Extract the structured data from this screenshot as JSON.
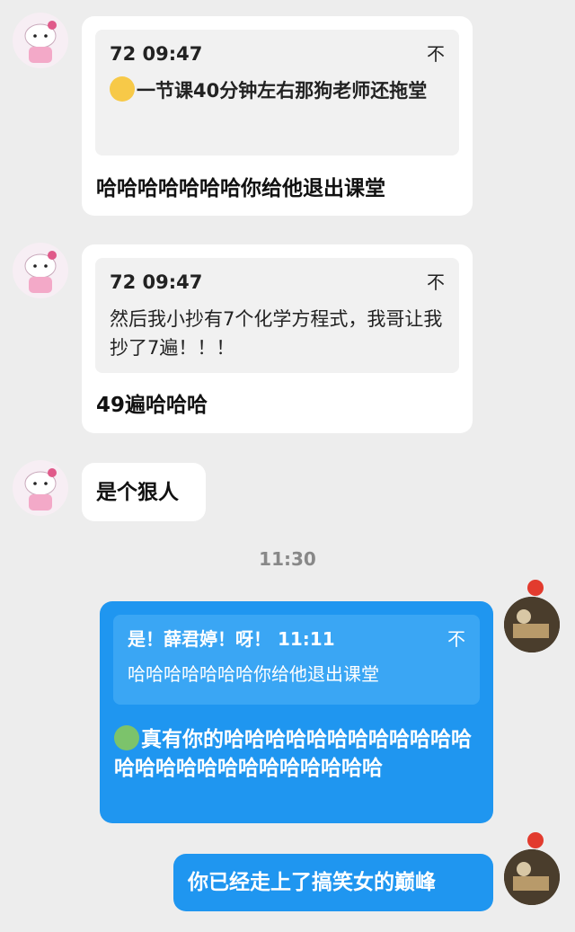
{
  "messages": [
    {
      "quote_meta": "72 09:47",
      "quote_emoji": "crying-face",
      "quote_text": "一节课40分钟左右那狗老师还拖堂",
      "reply": "哈哈哈哈哈哈哈你给他退出课堂"
    },
    {
      "quote_meta": "72 09:47",
      "quote_text": "然后我小抄有7个化学方程式，我哥让我抄了7遍！！！",
      "reply": "49遍哈哈哈"
    },
    {
      "reply": "是个狠人"
    }
  ],
  "timestamp": "11:30",
  "my_messages": [
    {
      "quote_meta": "是！薛君婷！呀！ 11:11",
      "quote_text": "哈哈哈哈哈哈哈你给他退出课堂",
      "reply_emoji": "green-creature",
      "reply": "真有你的哈哈哈哈哈哈哈哈哈哈哈哈哈哈哈哈哈哈哈哈哈哈哈哈哈"
    },
    {
      "reply": "你已经走上了搞笑女的巅峰"
    }
  ],
  "pin_icon_glyph": "不",
  "colors": {
    "background": "#ededed",
    "incoming_bubble": "#ffffff",
    "outgoing_bubble": "#1f96f0"
  }
}
